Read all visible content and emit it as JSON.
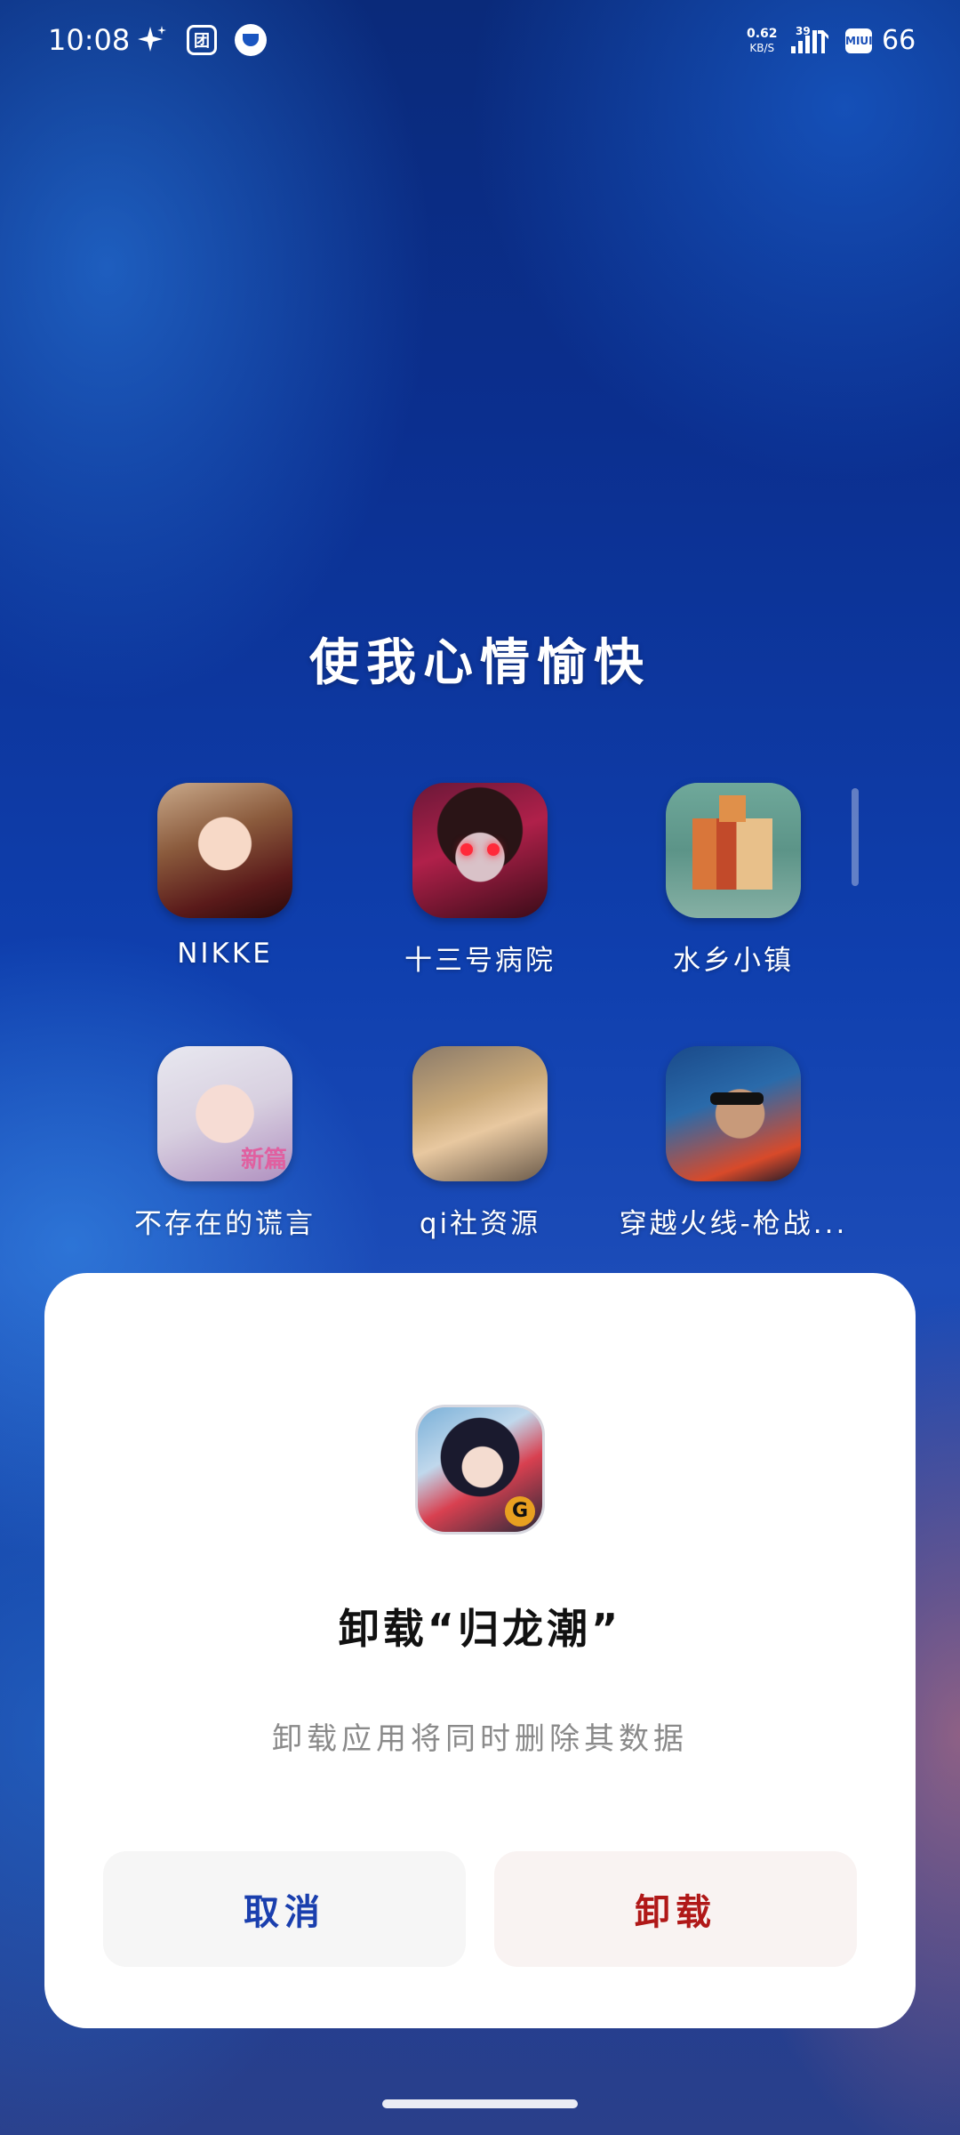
{
  "status_bar": {
    "time": "10:08",
    "net_speed_value": "0.62",
    "net_speed_unit": "KB/S",
    "signal_label": "39",
    "miui_badge": "MIUI",
    "battery": "66",
    "icons": [
      "sparkle-icon",
      "app-badge-icon",
      "water-drop-icon",
      "signal-icon",
      "miui-icon"
    ]
  },
  "folder": {
    "title": "使我心情愉快",
    "apps": [
      {
        "label": "NIKKE"
      },
      {
        "label": "十三号病院"
      },
      {
        "label": "水乡小镇"
      },
      {
        "label": "不存在的谎言"
      },
      {
        "label": "qi社资源"
      },
      {
        "label": "穿越火线-枪战..."
      }
    ]
  },
  "dialog": {
    "title": "卸载“归龙潮”",
    "message": "卸载应用将同时删除其数据",
    "cancel_label": "取消",
    "uninstall_label": "卸载",
    "cancel_color": "#1a3fae",
    "uninstall_color": "#b01818"
  }
}
